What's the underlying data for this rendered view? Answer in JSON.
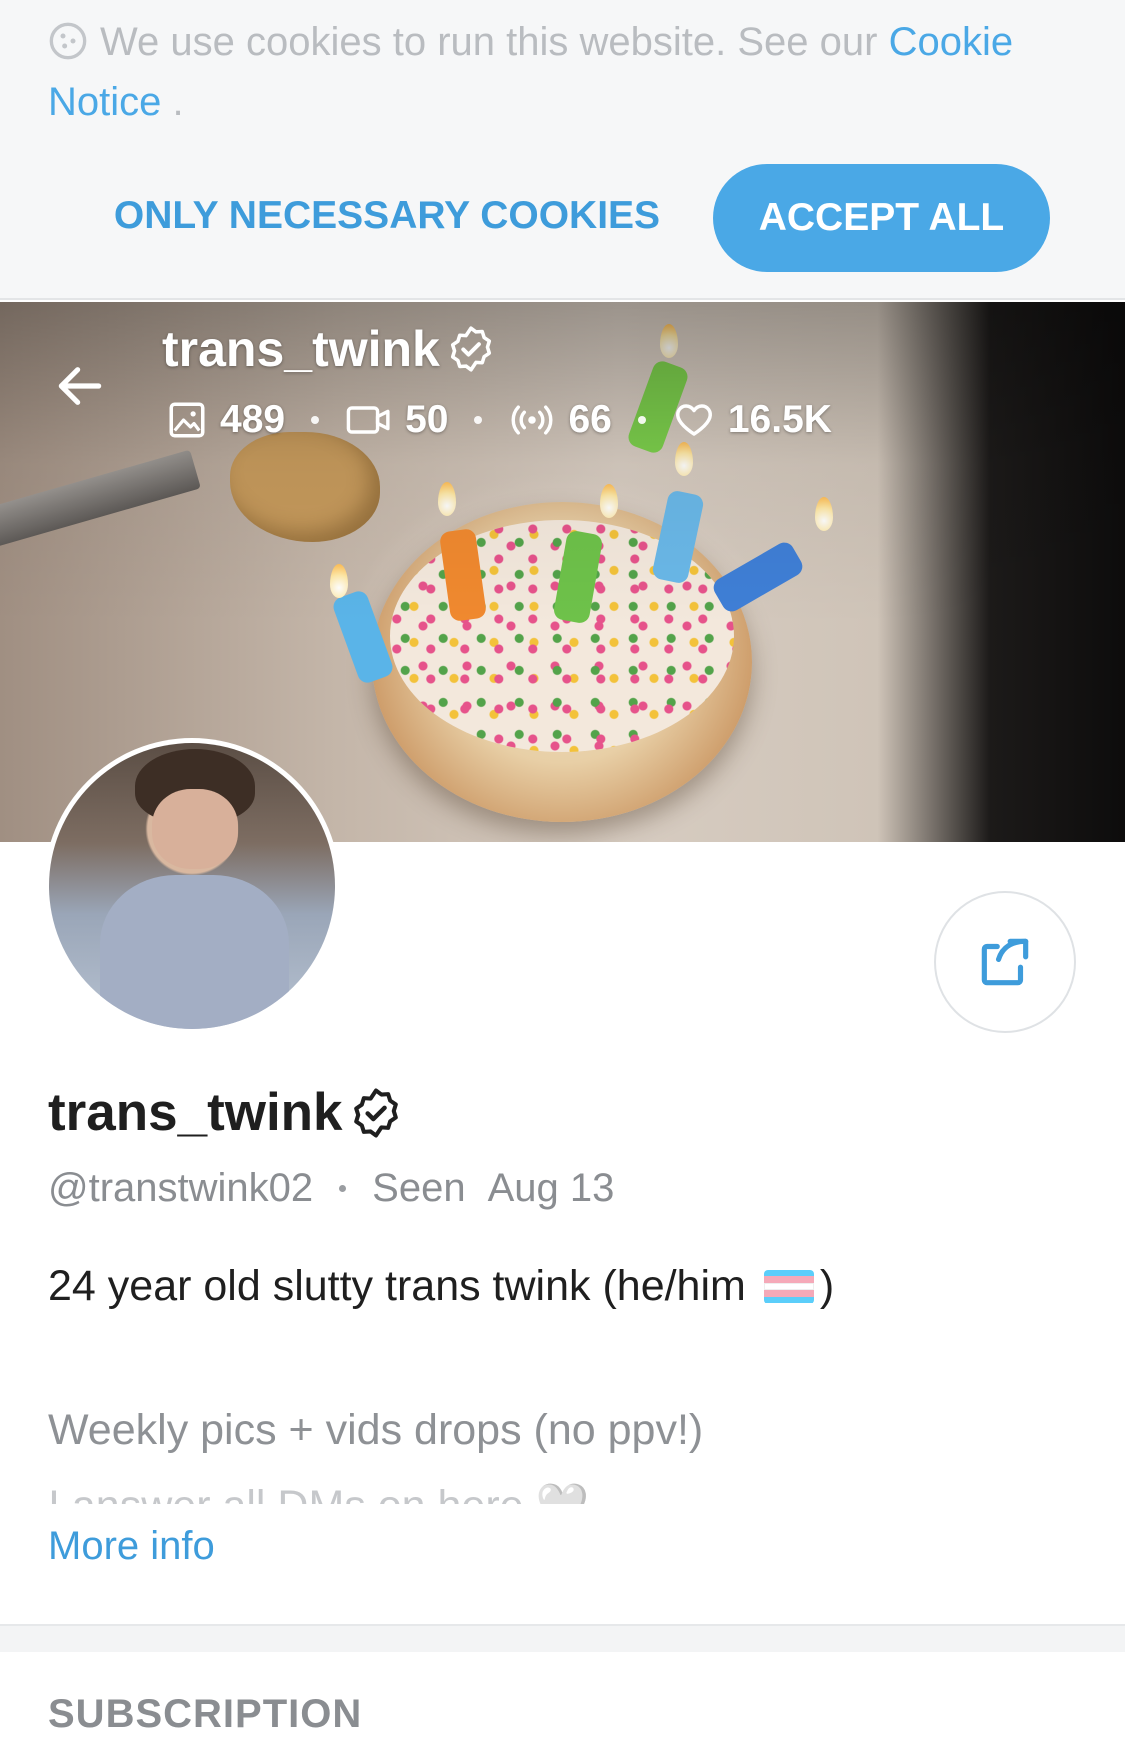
{
  "cookie_banner": {
    "text": "We use cookies to run this website. See our",
    "link_label": "Cookie Notice",
    "trailing": ".",
    "necessary_button": "ONLY NECESSARY COOKIES",
    "accept_button": "ACCEPT ALL"
  },
  "header": {
    "username": "trans_twink",
    "stats": {
      "photos": "489",
      "videos": "50",
      "streams": "66",
      "likes": "16.5K"
    }
  },
  "profile": {
    "name": "trans_twink",
    "handle": "@transtwink02",
    "seen_label": "Seen",
    "seen_date": "Aug 13",
    "bio_line1": "24 year old slutty trans twink (he/him",
    "bio_line1_end": ")",
    "bio_line2": "Weekly pics + vids drops (no ppv!)",
    "bio_line3": "I answer all DMs on here 🤍",
    "more_info": "More info"
  },
  "sections": {
    "subscription_title": "SUBSCRIPTION"
  },
  "colors": {
    "accent": "#4aa8e6",
    "verified": "#ffffff",
    "trans_flag": [
      "#5bcefa",
      "#f5a9b8",
      "#ffffff",
      "#f5a9b8",
      "#5bcefa"
    ]
  },
  "icons": {
    "back": "arrow-left-icon",
    "verified": "verified-badge-icon",
    "photos": "image-icon",
    "videos": "video-camera-icon",
    "streams": "broadcast-icon",
    "likes": "heart-icon",
    "share": "share-icon",
    "cookie": "cookie-icon"
  }
}
